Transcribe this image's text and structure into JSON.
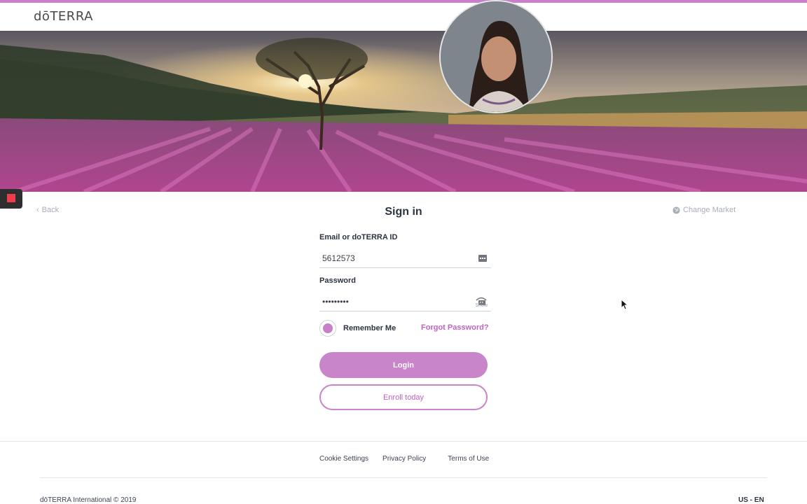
{
  "brand": {
    "logo_text": "dōTERRA",
    "accent": "#c97fca",
    "link_color": "#c261c6"
  },
  "nav": {
    "back_label": "Back",
    "change_market_label": "Change Market"
  },
  "signin": {
    "title": "Sign in",
    "email_label": "Email or doTERRA ID",
    "email_value": "5612573",
    "password_label": "Password",
    "password_value": "•••••••••",
    "show_label": "Show",
    "remember_label": "Remember Me",
    "remember_checked": true,
    "forgot_label": "Forgot Password?",
    "login_label": "Login",
    "enroll_label": "Enroll today"
  },
  "footer": {
    "links": [
      "Cookie Settings",
      "Privacy Policy",
      "Terms of Use"
    ],
    "copyright": "dōTERRA International © 2019",
    "locale": "US - EN"
  },
  "icons": {
    "back": "chevron-left-icon",
    "market": "globe-icon",
    "email_field": "keyboard-icon",
    "password_field": "eye-icon",
    "recording": "record-icon"
  }
}
